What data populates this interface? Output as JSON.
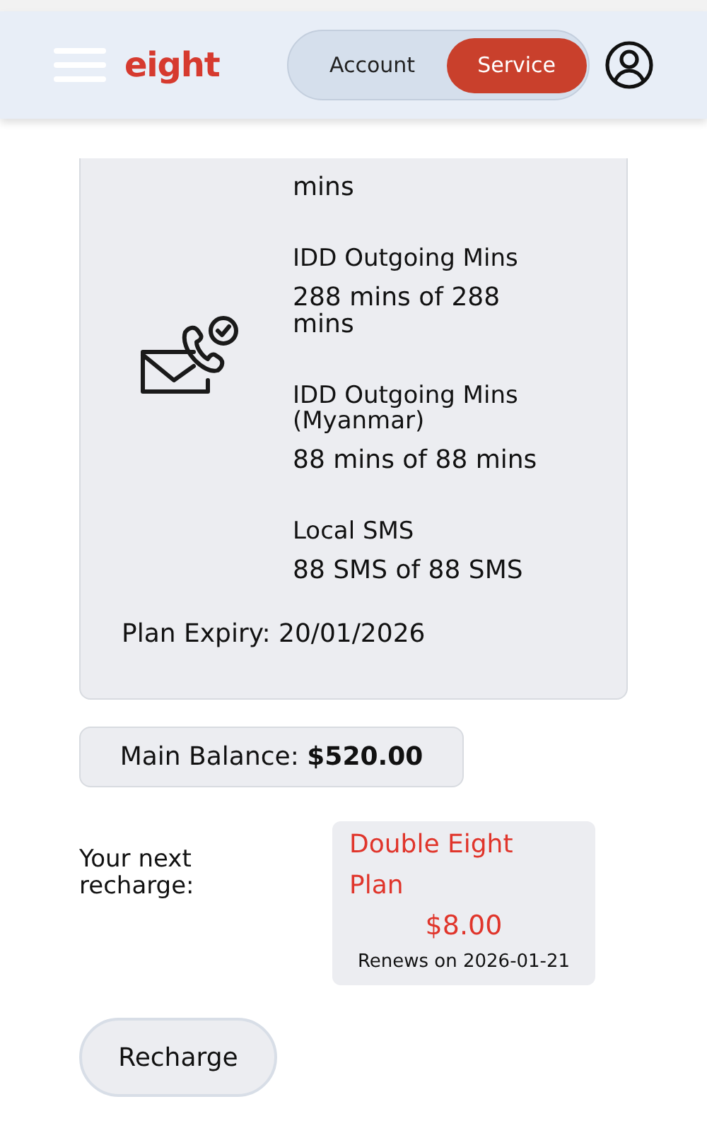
{
  "header": {
    "logo": "eight",
    "tabs": [
      {
        "label": "Account",
        "selected": false
      },
      {
        "label": "Service",
        "selected": true
      }
    ]
  },
  "plan_card": {
    "allowances": [
      {
        "value": "mins"
      },
      {
        "label": "IDD Outgoing Mins",
        "value": "288 mins of 288 mins"
      },
      {
        "label": "IDD Outgoing Mins (Myanmar)",
        "value": "88 mins of 88 mins"
      },
      {
        "label": "Local SMS",
        "value": "88 SMS of 88 SMS"
      }
    ],
    "expiry": "Plan Expiry: 20/01/2026"
  },
  "main_balance": "Main Balance: **$520.00**",
  "next_recharge": {
    "label": "Your next recharge:",
    "plan_name": "Double Eight Plan",
    "price": "$8.00",
    "renews": "Renews on 2026-01-21"
  },
  "recharge_button": "Recharge"
}
